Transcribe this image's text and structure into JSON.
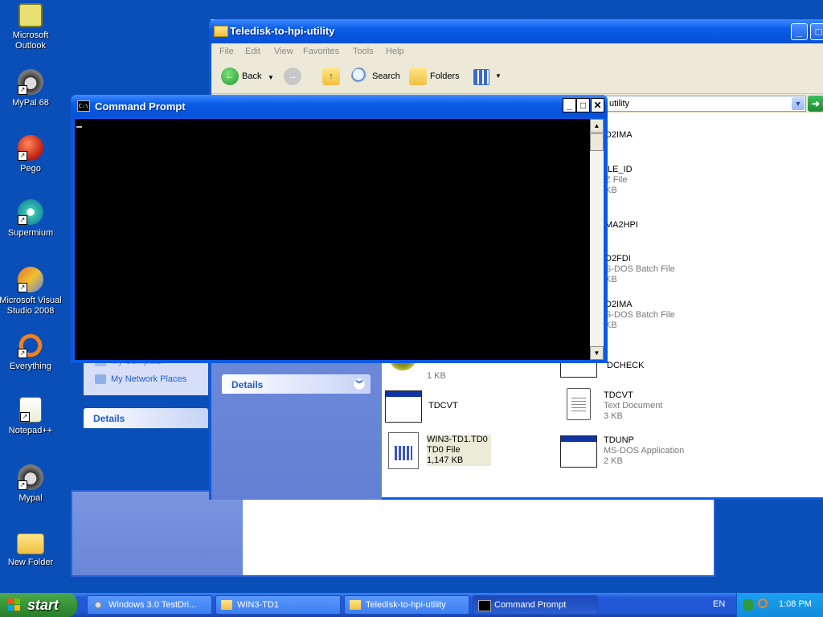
{
  "desktop": {
    "icons": [
      {
        "label": "Microsoft Outlook"
      },
      {
        "label": "MyPal 68"
      },
      {
        "label": "Pego"
      },
      {
        "label": "Supermium"
      },
      {
        "label": "Microsoft Visual Studio 2008"
      },
      {
        "label": "Everything"
      },
      {
        "label": "Notepad++"
      },
      {
        "label": "Mypal"
      },
      {
        "label": "New Folder"
      }
    ]
  },
  "explorer": {
    "title": "Teledisk-to-hpi-utility",
    "menu": [
      "File",
      "Edit",
      "View",
      "Favorites",
      "Tools",
      "Help"
    ],
    "toolbar": {
      "back": "Back",
      "search": "Search",
      "folders": "Folders"
    },
    "address": "utility",
    "places": [
      "My Computer",
      "My Network Places"
    ],
    "details_header_left": "Details",
    "details_header_right": "Details",
    "files": [
      {
        "name": "D2IMA",
        "sub1": "",
        "sub2": ""
      },
      {
        "name": "ILE_ID",
        "sub1": "Z File",
        "sub2": "KB"
      },
      {
        "name": "MA2HPI",
        "sub1": "",
        "sub2": ""
      },
      {
        "name": "D2FDI",
        "sub1": "S-DOS Batch File",
        "sub2": "KB"
      },
      {
        "name": "D2IMA",
        "sub1": "S-DOS Batch File",
        "sub2": "KB"
      },
      {
        "name": "",
        "sub1": "1 KB",
        "sub2": ""
      },
      {
        "name": "DCHECK",
        "sub1": "",
        "sub2": ""
      },
      {
        "name": "TDCVT",
        "sub1": "",
        "sub2": ""
      },
      {
        "name": "TDCVT",
        "sub1": "Text Document",
        "sub2": "3 KB"
      },
      {
        "name": "WIN3-TD1.TD0",
        "sub1": "TD0 File",
        "sub2": "1,147 KB"
      },
      {
        "name": "TDUNP",
        "sub1": "MS-DOS Application",
        "sub2": "2 KB"
      }
    ]
  },
  "cmd": {
    "title": "Command Prompt",
    "icon_text": "C:\\"
  },
  "taskbar": {
    "start": "start",
    "tasks": [
      {
        "label": "Windows 3.0 TestDri..."
      },
      {
        "label": "WIN3-TD1"
      },
      {
        "label": "Teledisk-to-hpi-utility"
      },
      {
        "label": "Command Prompt"
      }
    ],
    "language": "EN",
    "clock": "1:08 PM"
  },
  "colors": {
    "desktop": "#0a4fb8",
    "title_blue": "#0a5ce8",
    "start_green": "#3a9a3a",
    "tray": "#128cdc"
  }
}
